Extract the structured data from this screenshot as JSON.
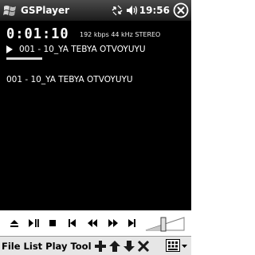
{
  "window": {
    "title": "GSPlayer",
    "time": "19:56",
    "start_icon": "windows-flag-icon",
    "tray_icons": [
      "connectivity-icon",
      "speaker-icon"
    ],
    "ok_icon": "close-icon"
  },
  "player": {
    "elapsed": "0:01:10",
    "stream_info": "192 kbps 44 kHz STEREO",
    "state_icon": "play-icon",
    "current_track": "001 - 10_YA TEBYA OTVOYUYU",
    "progress_fraction": 0.2,
    "playlist": [
      {
        "label": "001 - 10_YA TEBYA OTVOYUYU"
      }
    ]
  },
  "controls": {
    "buttons": [
      "eject-icon",
      "play-pause-icon",
      "stop-icon",
      "previous-track-icon",
      "rewind-icon",
      "fast-forward-icon",
      "next-track-icon"
    ],
    "volume_icon": "volume-slider"
  },
  "menu": {
    "items": [
      "File",
      "List",
      "Play",
      "Tool"
    ],
    "icons": [
      "add-icon",
      "move-up-icon",
      "move-down-icon",
      "delete-icon"
    ],
    "sip_icon": "keyboard-icon"
  }
}
